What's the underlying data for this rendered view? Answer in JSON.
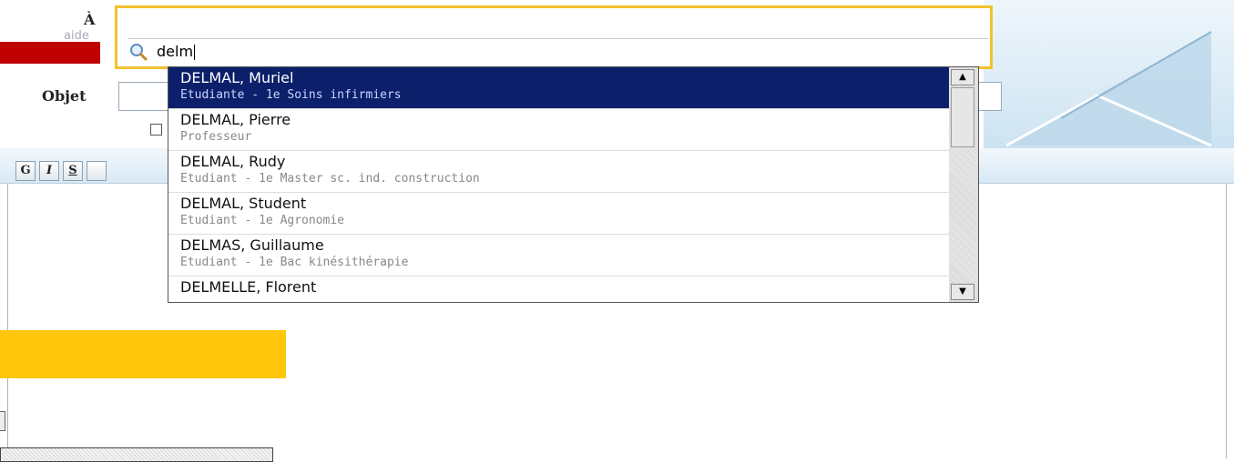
{
  "compose": {
    "to_label": "À",
    "help_label": "aide",
    "subject_label": "Objet",
    "search_query": "delm",
    "subject_value": ""
  },
  "toolbar": {
    "bold": "G",
    "italic": "I",
    "strike": "S",
    "more": ""
  },
  "suggestions": [
    {
      "name": "DELMAL, Muriel",
      "role": "Etudiante - 1e Soins infirmiers",
      "selected": true
    },
    {
      "name": "DELMAL, Pierre",
      "role": "Professeur",
      "selected": false
    },
    {
      "name": "DELMAL, Rudy",
      "role": "Etudiant - 1e Master sc. ind. construction",
      "selected": false
    },
    {
      "name": "DELMAL, Student",
      "role": "Etudiant - 1e Agronomie",
      "selected": false
    },
    {
      "name": "DELMAS, Guillaume",
      "role": "Etudiant - 1e Bac kinésithérapie",
      "selected": false
    },
    {
      "name": "DELMELLE, Florent",
      "role": "",
      "selected": false
    }
  ],
  "scrollbar": {
    "up": "▲",
    "down": "▼"
  },
  "colors": {
    "accent_yellow": "#ffc60b",
    "field_border": "#f3c12c",
    "selection": "#0b1f6a",
    "red_bar": "#c00000"
  }
}
